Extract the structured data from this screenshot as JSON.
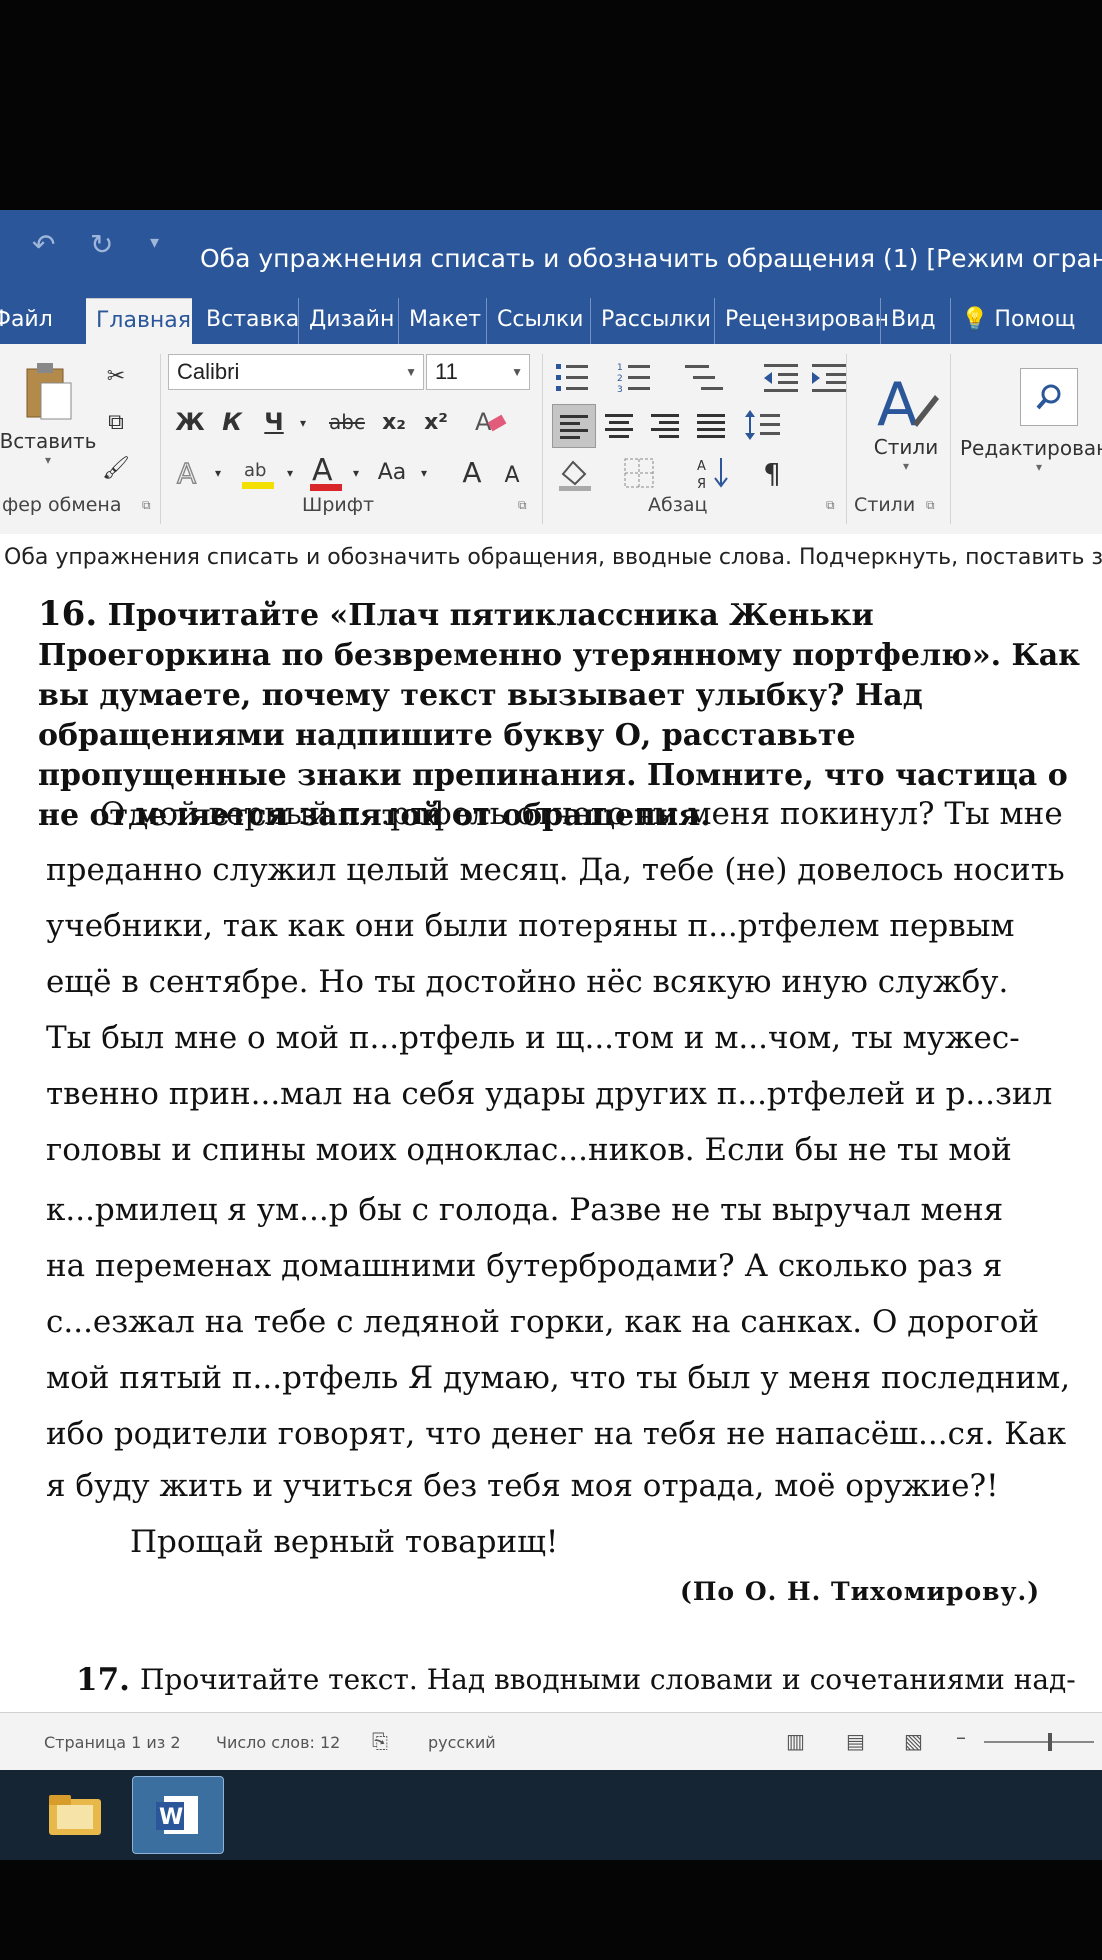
{
  "window": {
    "title": "Оба упражнения списать и обозначить обращения (1) [Режим ограниченной функ"
  },
  "tabs": [
    {
      "label": "Файл"
    },
    {
      "label": "Главная"
    },
    {
      "label": "Вставка"
    },
    {
      "label": "Дизайн"
    },
    {
      "label": "Макет"
    },
    {
      "label": "Ссылки"
    },
    {
      "label": "Рассылки"
    },
    {
      "label": "Рецензирован"
    },
    {
      "label": "Вид"
    },
    {
      "label": "Помощ"
    }
  ],
  "ribbon": {
    "clipboard": {
      "paste_label": "Вставить",
      "group_label": "фер обмена"
    },
    "font": {
      "name": "Calibri",
      "size": "11",
      "group_label": "Шрифт",
      "bold": "Ж",
      "italic": "К",
      "underline": "Ч",
      "strike": "abc",
      "sub": "x₂",
      "sup": "x²",
      "case": "Aa",
      "grow": "A",
      "shrink": "A",
      "color_letter": "A"
    },
    "paragraph": {
      "group_label": "Абзац"
    },
    "styles": {
      "label": "Стили",
      "group_label": "Стили"
    },
    "editing": {
      "label": "Редактирован"
    }
  },
  "doc_header": "Оба упражнения списать и обозначить обращения, вводные слова. Подчеркнуть, поставить зн",
  "exercise16": {
    "number": "16.",
    "instruction": "Прочитайте «Плач пятиклассника Женьки Проегоркина по безвременно утерянному портфелю». Как вы думаете, почему текст вызывает улыбку? Над обращениями надпишите букву О, расставьте пропущенные знаки препинания. Помните, что частица о не отделяется запятой от обращения.",
    "lines": [
      "О мой верный п...ртфель отчего ты меня покинул? Ты мне",
      "преданно служил целый месяц. Да, тебе (не) довелось носить",
      "учебники, так как они были потеряны п...ртфелем первым",
      "ещё в сентябре. Но ты достойно нёс всякую иную службу.",
      "Ты был мне о мой п...ртфель и щ...том и м...чом, ты мужес-",
      "твенно прин...мал на себя удары других п...ртфелей и р...зил",
      "головы и спины моих одноклас...ников. Если бы не ты мой",
      "к...рмилец я ум...р бы с голода. Разве не ты выручал меня",
      "на переменах домашними бутербродами? А сколько раз я",
      "с...езжал на тебе с ледяной горки, как на санках. О дорогой",
      "мой пятый п...ртфель   Я думаю, что ты был у меня последним,",
      "ибо родители говорят, что денег на тебя не напасёш...ся. Как",
      "я буду жить и учиться без тебя моя отрада, моё оружие?!",
      "Прощай верный товарищ!"
    ],
    "attribution": "(По О. Н. Тихомирову.)"
  },
  "exercise17": {
    "number": "17.",
    "text": "Прочитайте текст. Над вводными словами и сочетаниями над-"
  },
  "status": {
    "page": "Страница 1 из 2",
    "words": "Число слов: 12",
    "language": "русский"
  },
  "colors": {
    "ribbon_blue": "#2b579a",
    "taskbar": "#152533"
  }
}
